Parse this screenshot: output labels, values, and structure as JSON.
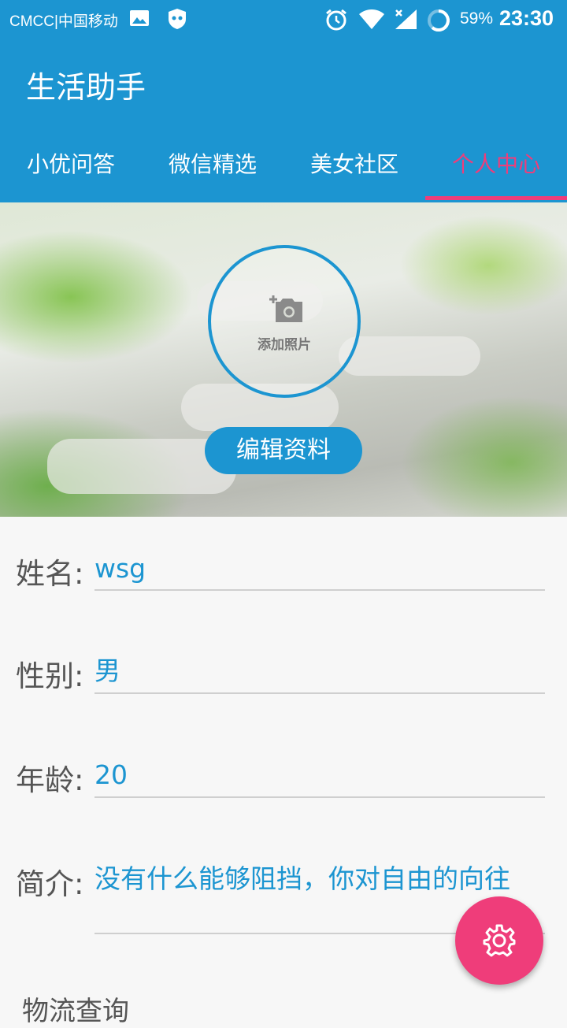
{
  "status_bar": {
    "carrier": "CMCC|中国移动",
    "battery": "59%",
    "time": "23:30"
  },
  "app": {
    "title": "生活助手"
  },
  "tabs": [
    {
      "label": "小优问答",
      "active": false
    },
    {
      "label": "微信精选",
      "active": false
    },
    {
      "label": "美女社区",
      "active": false
    },
    {
      "label": "个人中心",
      "active": true
    }
  ],
  "profile": {
    "add_photo_label": "添加照片",
    "edit_button": "编辑资料",
    "fields": [
      {
        "label": "姓名:",
        "value": "wsg"
      },
      {
        "label": "性别:",
        "value": "男"
      },
      {
        "label": "年龄:",
        "value": "20"
      },
      {
        "label": "简介:",
        "value": "没有什么能够阻挡，你对自由的向往"
      }
    ],
    "next_section": "物流查询"
  },
  "colors": {
    "primary": "#1c95d1",
    "accent": "#ef3d7a"
  },
  "icons": {
    "fab": "gear-icon",
    "avatar": "add-camera-icon"
  }
}
